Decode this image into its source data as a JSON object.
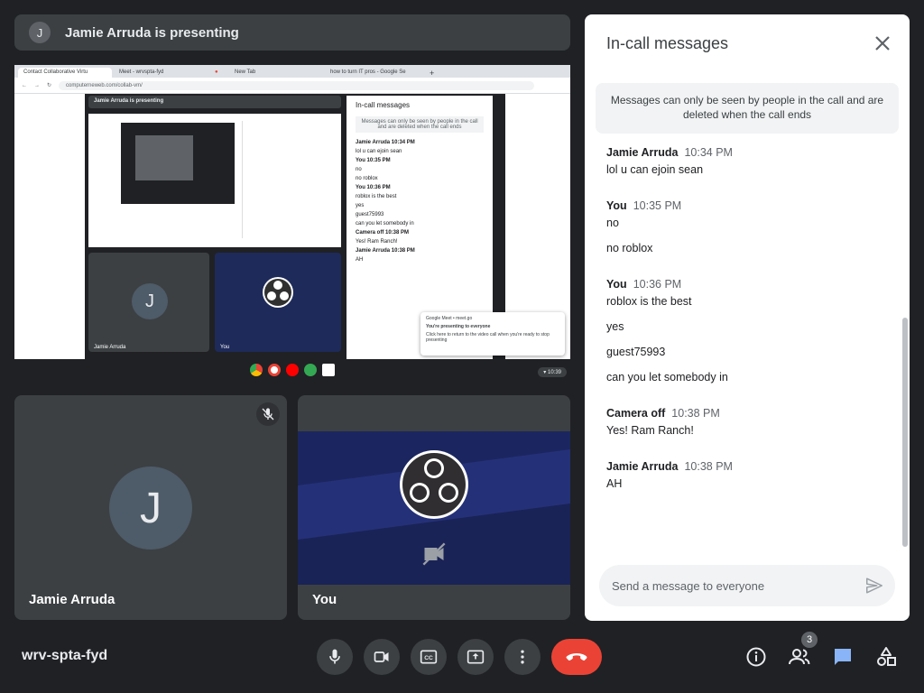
{
  "banner": {
    "avatar_letter": "J",
    "text": "Jamie Arruda is presenting"
  },
  "shared_screen": {
    "tabs": [
      "Contact Collaborative Virtu",
      "Meet - wrvspta-fyd",
      "",
      "New Tab",
      "how to turn IT pros - Google Se"
    ],
    "url": "computerneweb.com/collab-vm/",
    "inner_banner": "Jamie Arruda is presenting",
    "inner_chat_title": "In-call messages",
    "inner_chat_note": "Messages can only be seen by people in the call and are deleted when the call ends",
    "inner_lines": [
      "Jamie Arruda 10:34 PM",
      "lol u can ejoin sean",
      "You 10:35 PM",
      "no",
      "no roblox",
      "You 10:36 PM",
      "roblox is the best",
      "yes",
      "guest75993",
      "can you let somebody in",
      "Camera off 10:38 PM",
      "Yes! Ram Ranch!",
      "Jamie Arruda 10:38 PM",
      "AH"
    ],
    "inner_tile_names": [
      "Jamie Arruda",
      "You"
    ],
    "toast_title": "Google Meet • meet.go",
    "toast_text": "You're presenting to everyone",
    "toast_sub": "Click here to return to the video call when you're ready to stop presenting",
    "clock": "10:39"
  },
  "tiles": [
    {
      "name": "Jamie Arruda",
      "avatar_letter": "J"
    },
    {
      "name": "You"
    }
  ],
  "chat": {
    "title": "In-call messages",
    "note": "Messages can only be seen by people in the call and are deleted when the call ends",
    "groups": [
      {
        "sender": "Jamie Arruda",
        "time": "10:34 PM",
        "messages": [
          "lol u can ejoin sean"
        ]
      },
      {
        "sender": "You",
        "time": "10:35 PM",
        "messages": [
          "no",
          "no roblox"
        ]
      },
      {
        "sender": "You",
        "time": "10:36 PM",
        "messages": [
          "roblox is the best",
          "yes",
          "guest75993",
          "can you let somebody in"
        ]
      },
      {
        "sender": "Camera off",
        "time": "10:38 PM",
        "messages": [
          "Yes! Ram Ranch!"
        ]
      },
      {
        "sender": "Jamie Arruda",
        "time": "10:38 PM",
        "messages": [
          "AH"
        ]
      }
    ],
    "input_placeholder": "Send a message to everyone"
  },
  "bottom_bar": {
    "meeting_code": "wrv-spta-fyd",
    "people_count": "3",
    "controls": [
      "mic-icon",
      "camera-icon",
      "captions-icon",
      "present-icon",
      "more-options-icon",
      "hangup-icon"
    ],
    "right_icons": [
      "info-icon",
      "people-icon",
      "chat-icon",
      "activities-icon"
    ],
    "accent": "#8ab4f8",
    "hangup_color": "#ea4335"
  }
}
